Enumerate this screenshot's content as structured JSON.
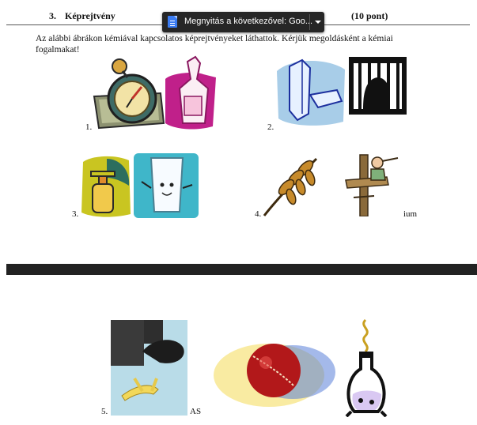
{
  "task": {
    "number": "3.",
    "title": "Képrejtvény",
    "points": "(10 pont)"
  },
  "open_with": {
    "label": "Megnyitás a következővel: Goo...",
    "app_icon": "google-docs-icon"
  },
  "intro": "Az alábbi ábrákon kémiával kapcsolatos képrejtvényeket láthattok. Kérjük megoldásként a kémiai fogalmakat!",
  "puzzles": [
    {
      "number": "1.",
      "images": [
        "clock-icon",
        "bottle-icon"
      ],
      "suffix": ""
    },
    {
      "number": "2.",
      "images": [
        "crystal-icon",
        "jail-icon"
      ],
      "suffix": ""
    },
    {
      "number": "3.",
      "images": [
        "gas-canister-icon",
        "glass-of-water-icon"
      ],
      "suffix": ""
    },
    {
      "number": "4.",
      "images": [
        "wheat-icon",
        "lookout-man-icon"
      ],
      "suffix": "ium"
    },
    {
      "number": "5.",
      "images": [
        "banana-slip-photo",
        "cricket-ball-photo",
        "flask-icon"
      ],
      "suffix": "AS"
    }
  ]
}
